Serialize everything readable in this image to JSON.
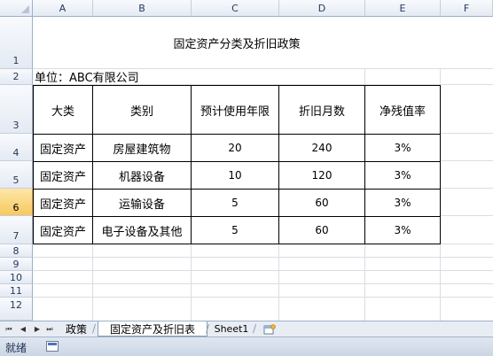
{
  "columns": [
    "A",
    "B",
    "C",
    "D",
    "E",
    "F"
  ],
  "rows": [
    "1",
    "2",
    "3",
    "4",
    "5",
    "6",
    "7",
    "8",
    "9",
    "10",
    "11",
    "12"
  ],
  "selected_row": "6",
  "sheet": {
    "title": "固定资产分类及折旧政策",
    "unit": "单位：ABC有限公司",
    "headers": [
      "大类",
      "类别",
      "预计使用年限",
      "折旧月数",
      "净残值率"
    ],
    "records": [
      [
        "固定资产",
        "房屋建筑物",
        "20",
        "240",
        "3%"
      ],
      [
        "固定资产",
        "机器设备",
        "10",
        "120",
        "3%"
      ],
      [
        "固定资产",
        "运输设备",
        "5",
        "60",
        "3%"
      ],
      [
        "固定资产",
        "电子设备及其他",
        "5",
        "60",
        "3%"
      ]
    ]
  },
  "tabs": {
    "nav_first": "⏮",
    "nav_prev": "◀",
    "nav_next": "▶",
    "nav_last": "⏭",
    "items": [
      "政策",
      "固定资产及折旧表",
      "Sheet1"
    ],
    "active": "固定资产及折旧表"
  },
  "status": {
    "ready": "就绪"
  }
}
